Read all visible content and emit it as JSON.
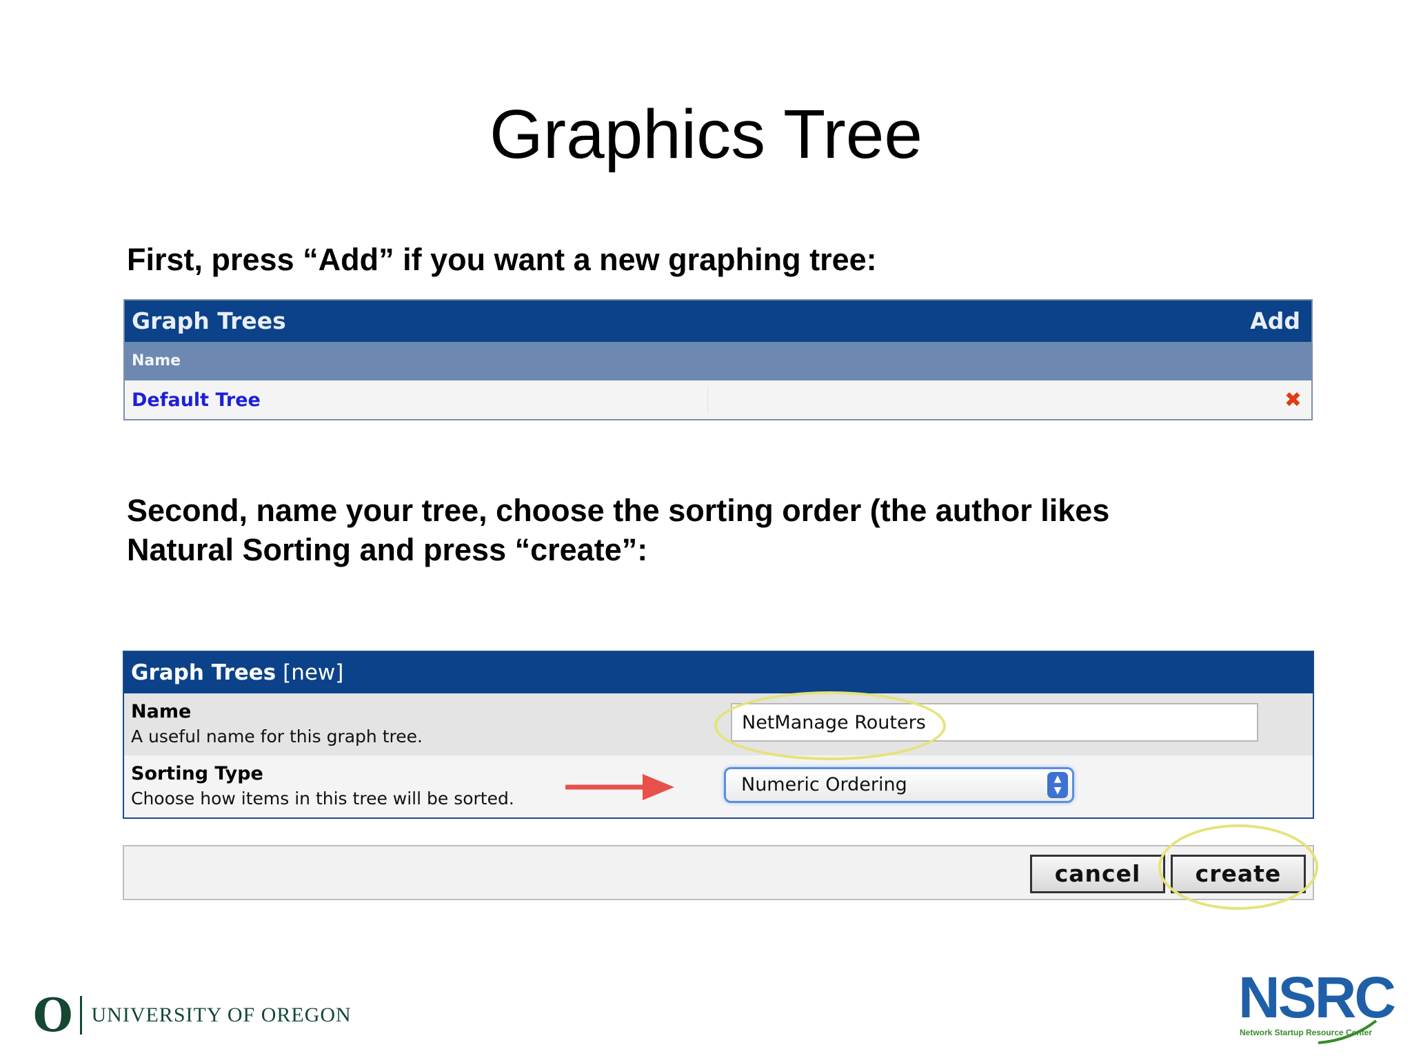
{
  "slide": {
    "title": "Graphics Tree",
    "instruction_1": "First, press “Add” if you want a new graphing tree:",
    "instruction_2_line1": "Second, name your tree, choose the sorting order (the author likes",
    "instruction_2_line2": "Natural Sorting and press “create”:"
  },
  "tree_list_panel": {
    "header_title": "Graph Trees",
    "add_link": "Add",
    "column_name": "Name",
    "rows": [
      {
        "name": "Default Tree",
        "delete_icon": "close-x-icon"
      }
    ]
  },
  "new_tree_form": {
    "header_title": "Graph Trees",
    "header_suffix": "[new]",
    "name_label": "Name",
    "name_description": "A useful name for this graph tree.",
    "name_value": "NetManage Routers",
    "sort_label": "Sorting Type",
    "sort_description": "Choose how items in this tree will be sorted.",
    "sort_value": "Numeric Ordering",
    "cancel_label": "cancel",
    "create_label": "create"
  },
  "annotations": {
    "highlight_color": "#e6e27a",
    "arrow_color": "#e8504a"
  },
  "logos": {
    "university": "UNIVERSITY OF OREGON",
    "university_mark": "O",
    "nsrc": "NSRC",
    "nsrc_sub": "Network Startup Resource Center"
  },
  "colors": {
    "panel_header": "#0b4289",
    "column_header": "#6d89b1",
    "link": "#1e1ed8"
  }
}
